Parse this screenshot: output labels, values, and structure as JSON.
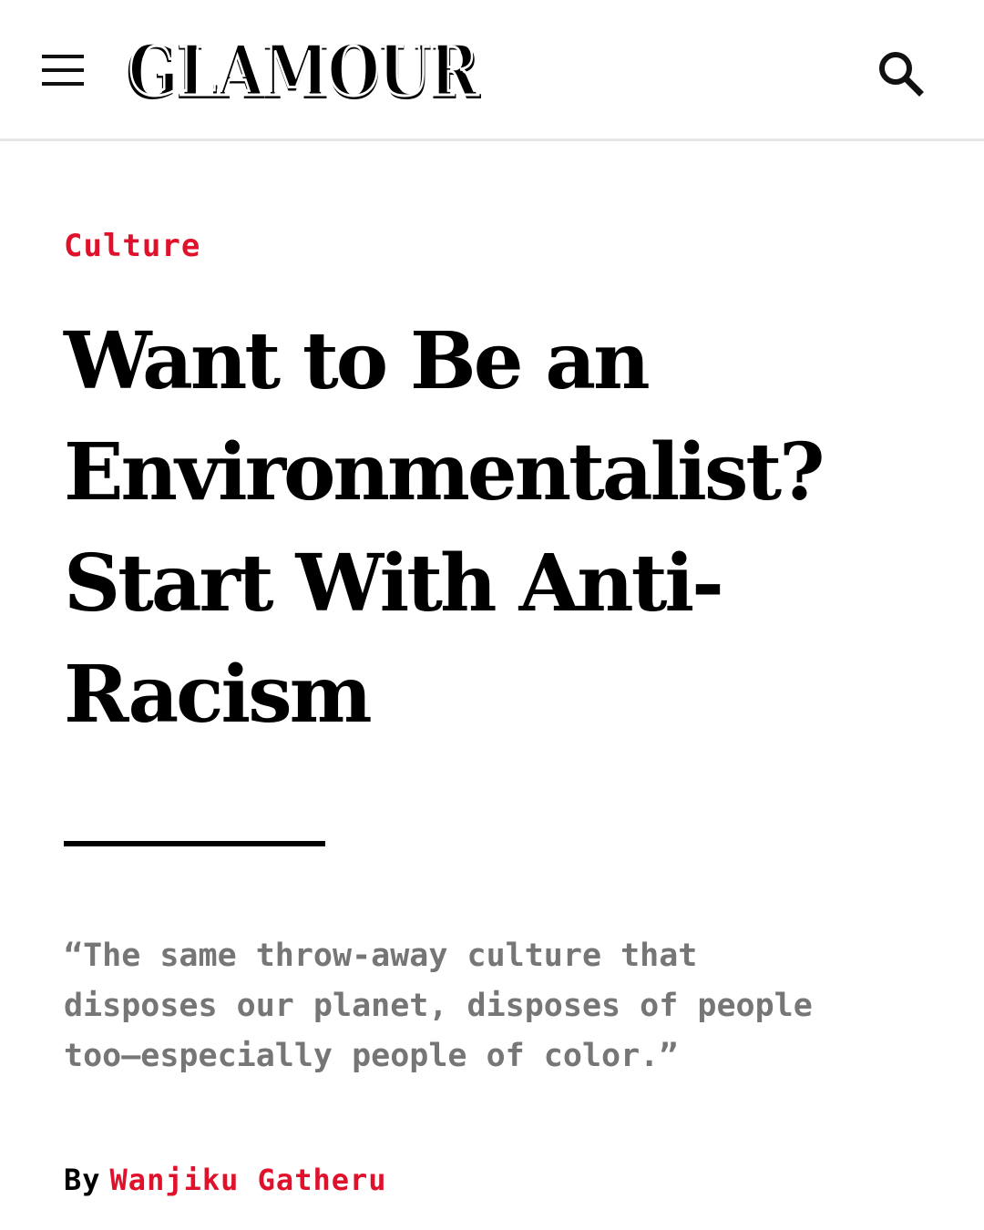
{
  "header": {
    "menu_icon": "hamburger-menu-icon",
    "logo_text": "GLAMOUR",
    "search_icon": "search-icon"
  },
  "article": {
    "category": "Culture",
    "headline_lines": [
      "Want to Be an",
      "Environmentalist?",
      "Start With Anti-",
      "Racism"
    ],
    "dek_lines": [
      "“The same throw-away culture that",
      "disposes our planet, disposes of people",
      "too—especially people of color.”"
    ],
    "byline_prefix": "By",
    "author": "Wanjiku Gatheru"
  },
  "colors": {
    "accent": "#e0112b",
    "dek_gray": "#767676",
    "text": "#000000",
    "divider": "#e6e6e6"
  }
}
